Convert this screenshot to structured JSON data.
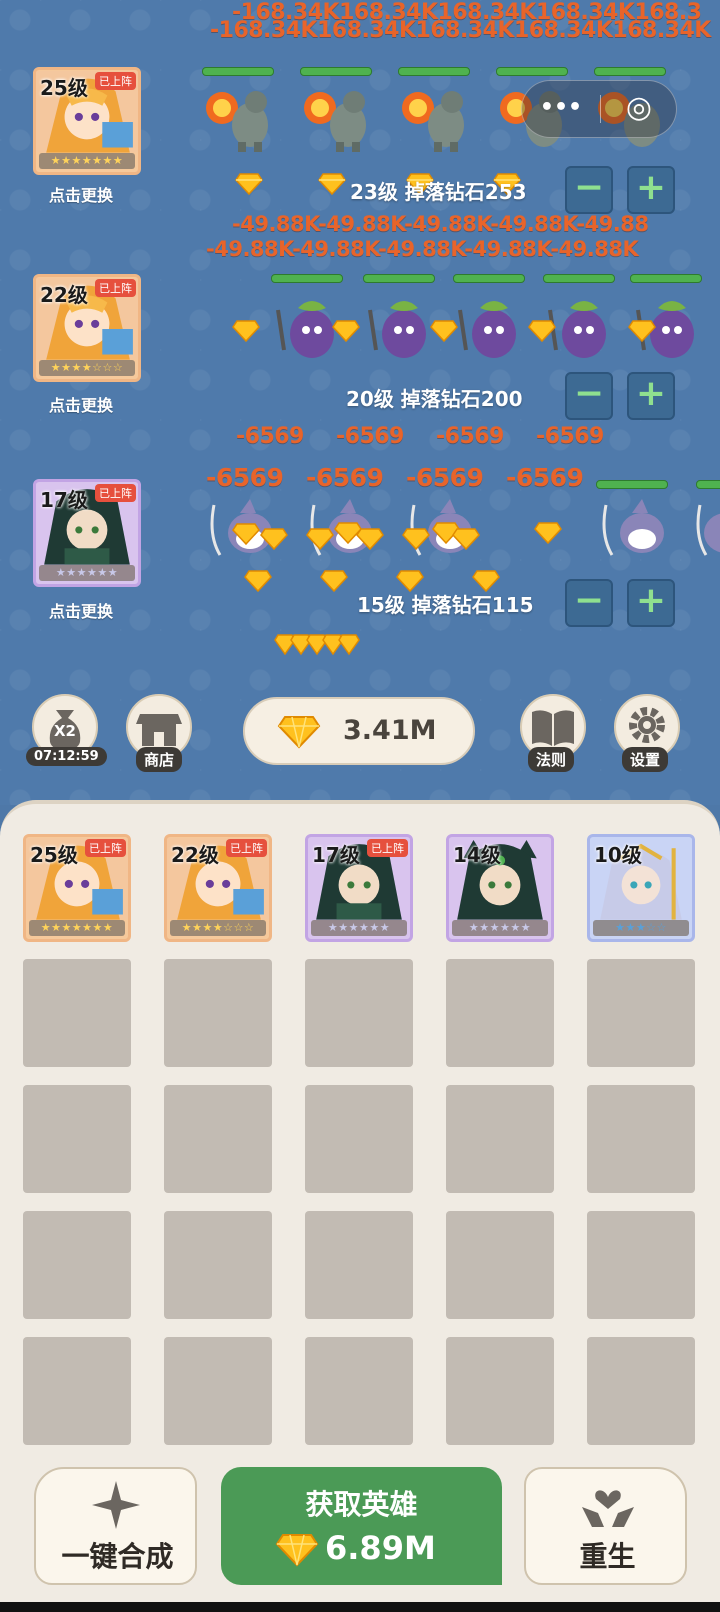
{
  "rows": [
    {
      "hero": {
        "level": "25级",
        "status": "已上阵",
        "stars": "★★★★★★★",
        "switch_label": "点击更换"
      },
      "info": "23级 掉落钻石253",
      "damage_top": "-168.34K168.34K168.34K168.34K168.3",
      "damage_bottom": "-168.34K168.34K168.34K168.34K168.34K",
      "monster": "godzilla"
    },
    {
      "hero": {
        "level": "22级",
        "status": "已上阵",
        "stars": "★★★★☆☆☆",
        "switch_label": "点击更换"
      },
      "info": "20级 掉落钻石200",
      "damage_top": "-49.88K-49.88K-49.88K-49.88K-49.88",
      "damage_bottom": "-49.88K-49.88K-49.88K-49.88K-49.88K",
      "monster": "eggplant"
    },
    {
      "hero": {
        "level": "17级",
        "status": "已上阵",
        "stars": "★★★★★★",
        "switch_label": "点击更换"
      },
      "info": "15级 掉落钻石115",
      "damage_top": [
        "-6569",
        "-6569",
        "-6569",
        "-6569"
      ],
      "damage_bottom": [
        "-6569",
        "-6569",
        "-6569",
        "-6569"
      ],
      "monster": "shark"
    }
  ],
  "controls": {
    "minus": "−",
    "plus": "+",
    "capsule_more": "•••",
    "capsule_close": "◎"
  },
  "toolbar": {
    "x2_label": "X2",
    "timer": "07:12:59",
    "shop_label": "商店",
    "diamonds": "3.41M",
    "rules_label": "法则",
    "settings_label": "设置"
  },
  "inventory": [
    {
      "level": "25级",
      "status": "已上阵",
      "stars": "★★★★★★★",
      "type": "orange"
    },
    {
      "level": "22级",
      "status": "已上阵",
      "stars": "★★★★☆☆☆",
      "type": "orange"
    },
    {
      "level": "17级",
      "status": "已上阵",
      "stars": "★★★★★★",
      "type": "purple"
    },
    {
      "level": "14级",
      "status": "",
      "stars": "★★★★★★",
      "type": "purple"
    },
    {
      "level": "10级",
      "status": "",
      "stars": "★★★☆☆",
      "type": "blue"
    }
  ],
  "bottom": {
    "merge_label": "一键合成",
    "get_hero_label": "获取英雄",
    "get_hero_cost": "6.89M",
    "rebirth_label": "重生"
  },
  "colors": {
    "battle_bg": "#4f7aab",
    "damage": "#e8642a",
    "hp": "#4fb24f",
    "get_button": "#4b9a56",
    "panel_bg": "#f0ebe3",
    "slot": "#c2bbb3"
  }
}
